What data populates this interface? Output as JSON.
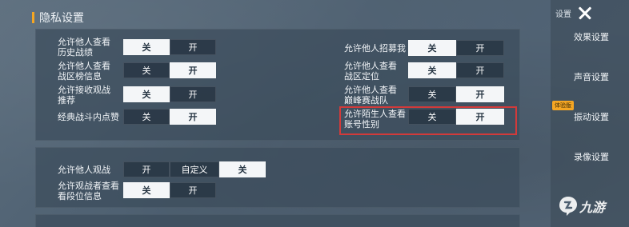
{
  "header": {
    "title": "隐私设置"
  },
  "panel1": {
    "left_rows": [
      {
        "label": "允许他人查看\n历史战绩",
        "options": [
          "关",
          "开"
        ],
        "selected": 0
      },
      {
        "label": "允许他人查看\n战区榜信息",
        "options": [
          "关",
          "开"
        ],
        "selected": 1
      },
      {
        "label": "允许接收观战\n推荐",
        "options": [
          "关",
          "开"
        ],
        "selected": 0
      },
      {
        "label": "经典战斗内点赞",
        "options": [
          "关",
          "开"
        ],
        "selected": 1
      }
    ],
    "right_rows": [
      {
        "label": "允许他人招募我",
        "options": [
          "关",
          "开"
        ],
        "selected": 0
      },
      {
        "label": "允许他人查看\n战区定位",
        "options": [
          "关",
          "开"
        ],
        "selected": 0
      },
      {
        "label": "允许他人查看\n巅峰赛战队",
        "options": [
          "关",
          "开"
        ],
        "selected": 1
      },
      {
        "label": "允许陌生人查看\n账号性别",
        "options": [
          "关",
          "开"
        ],
        "selected": 1
      }
    ]
  },
  "panel2": {
    "rows": [
      {
        "label": "允许他人观战",
        "options": [
          "开",
          "自定义",
          "关"
        ],
        "selected": 2
      },
      {
        "label": "允许观战者查看\n看段位信息",
        "options": [
          "关",
          "开"
        ],
        "selected": 0
      }
    ]
  },
  "sidebar": {
    "title": "设置",
    "badge": "体验版",
    "items": [
      "效果设置",
      "声音设置",
      "振动设置",
      "录像设置"
    ]
  },
  "watermark": {
    "text": "九游"
  },
  "colors": {
    "accent": "#f5a623",
    "highlight": "#d23a3a",
    "active_seg": "#f4f6f8"
  }
}
